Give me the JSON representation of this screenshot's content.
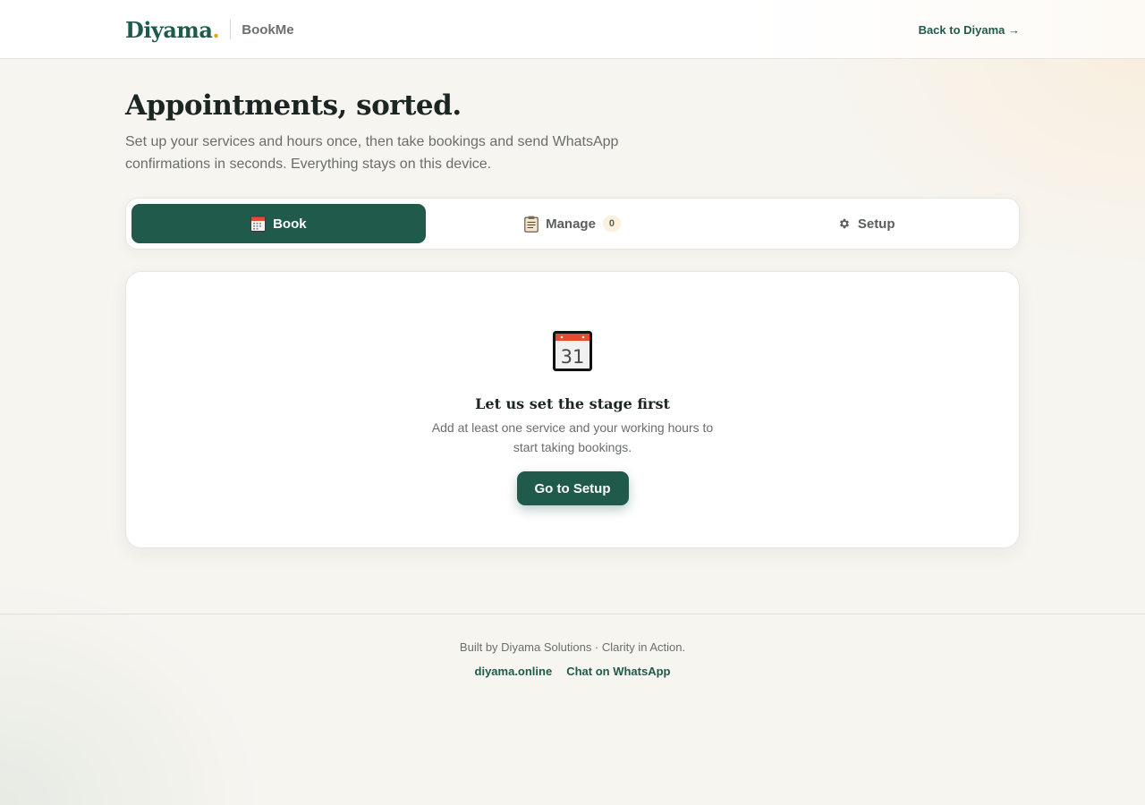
{
  "header": {
    "logo": "Diyama",
    "logo_dot": ".",
    "product": "BookMe",
    "back_link": "Back to Diyama →"
  },
  "hero": {
    "title": "Appointments, sorted.",
    "subtitle": "Set up your services and hours once, then take bookings and send WhatsApp confirmations in seconds. Everything stays on this device."
  },
  "tabs": [
    {
      "label": "Book",
      "icon": "calendar-icon",
      "active": true
    },
    {
      "label": "Manage",
      "icon": "clipboard-icon",
      "badge": "0"
    },
    {
      "label": "Setup",
      "icon": "gear-icon"
    }
  ],
  "empty_state": {
    "icon": "calendar-31-icon",
    "icon_day": "31",
    "title": "Let us set the stage first",
    "text": "Add at least one service and your working hours to start taking bookings.",
    "button": "Go to Setup"
  },
  "footer": {
    "text": "Built by Diyama Solutions · Clarity in Action.",
    "links": [
      "diyama.online",
      "Chat on WhatsApp"
    ]
  },
  "colors": {
    "brand_green": "#1f5a4b",
    "accent_gold": "#e0a81c",
    "calendar_red": "#e34c2f"
  }
}
